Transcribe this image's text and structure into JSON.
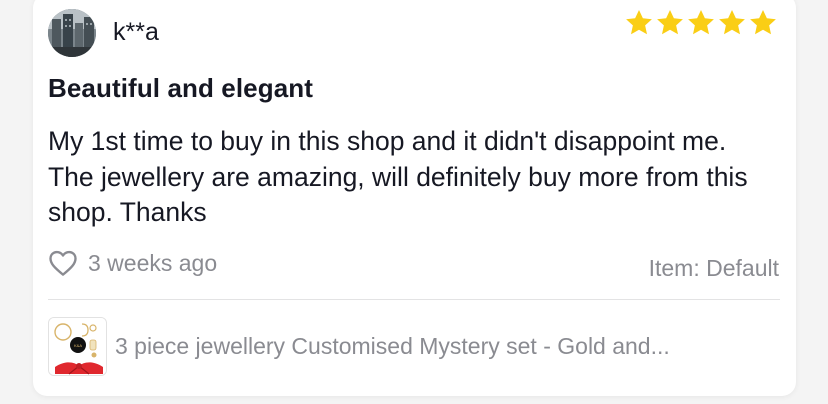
{
  "review": {
    "username": "k**a",
    "rating": 5,
    "rating_max": 5,
    "title": "Beautiful and elegant",
    "body": "My 1st time to buy in this shop and it didn't disappoint me. The jewellery are amazing, will definitely buy more from this shop. Thanks",
    "time_ago": "3 weeks ago",
    "item_variant": "Item: Default"
  },
  "product": {
    "name": "3 piece jewellery Customised Mystery set - Gold and..."
  },
  "icons": {
    "avatar": "user-avatar-photo",
    "star": "star-icon",
    "like": "heart-outline-icon",
    "product": "product-thumbnail"
  },
  "colors": {
    "star": "#FACE15",
    "text_primary": "#161823",
    "text_secondary": "#8A8B91",
    "divider": "#E3E3E4",
    "gift_ribbon": "#E0282E"
  }
}
